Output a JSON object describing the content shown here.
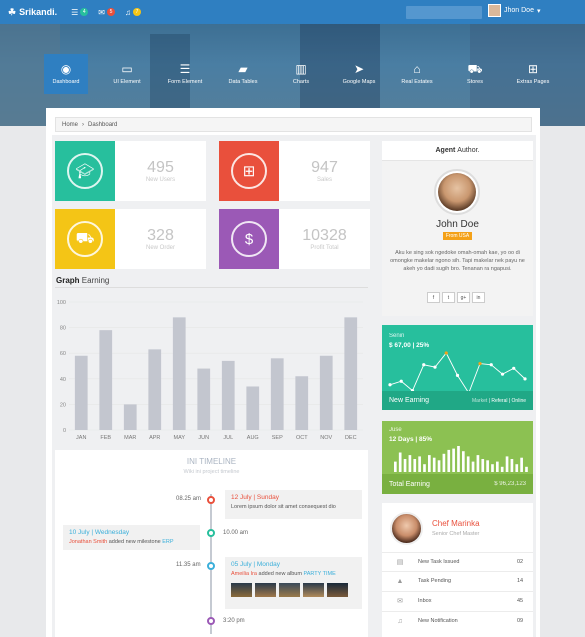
{
  "topbar": {
    "brand": "Srikandi.",
    "badges": [
      "4",
      "5",
      "7"
    ],
    "search_placeholder": "",
    "user": "Jhon Doe"
  },
  "nav": [
    {
      "label": "Dashboard",
      "icon": "dashboard-icon"
    },
    {
      "label": "UI Element",
      "icon": "laptop-icon"
    },
    {
      "label": "Form Element",
      "icon": "list-icon"
    },
    {
      "label": "Data Tables",
      "icon": "folder-icon"
    },
    {
      "label": "Charts",
      "icon": "bar-chart-icon"
    },
    {
      "label": "Google Maps",
      "icon": "location-icon"
    },
    {
      "label": "Real Estates",
      "icon": "home-icon"
    },
    {
      "label": "Stores",
      "icon": "cart-icon"
    },
    {
      "label": "Extras Pages",
      "icon": "plus-icon"
    }
  ],
  "breadcrumb": {
    "home": "Home",
    "current": "Dashboard"
  },
  "stats": [
    {
      "value": "495",
      "label": "New Users",
      "color": "#27bf9d",
      "icon": "graduation-cap-icon"
    },
    {
      "value": "947",
      "label": "Sales",
      "color": "#e9503c",
      "icon": "gift-icon"
    },
    {
      "value": "328",
      "label": "New Order",
      "color": "#f4c516",
      "icon": "cart-icon"
    },
    {
      "value": "10328",
      "label": "Profit Total",
      "color": "#9b59b6",
      "icon": "money-icon"
    }
  ],
  "graph": {
    "title_bold": "Graph",
    "title_rest": "Earning"
  },
  "chart_data": {
    "type": "bar",
    "categories": [
      "JAN",
      "FEB",
      "MAR",
      "APR",
      "MAY",
      "JUN",
      "JUL",
      "AUG",
      "SEP",
      "OCT",
      "NOV",
      "DEC"
    ],
    "values": [
      58,
      78,
      20,
      63,
      88,
      48,
      54,
      34,
      56,
      42,
      58,
      88
    ],
    "ylim": [
      0,
      100
    ],
    "yticks": [
      0,
      20,
      40,
      60,
      80,
      100
    ],
    "bar_color": "#c3c6cf"
  },
  "timeline": {
    "title": "INI TIMELINE",
    "subtitle": "Wiki ini project timeline",
    "events": [
      {
        "time": "08.25 am",
        "title": "12 July | Sunday",
        "text": "Lorem ipsum dolor sit amet consequest dio",
        "side": "right",
        "color": "#e9503c"
      },
      {
        "time": "10.00 am",
        "title": "10 July | Wednesday",
        "text_name": "Jonathan Smith",
        "text": "added new milestone",
        "text_tag": "ERP",
        "side": "left",
        "color": "#27bf9d"
      },
      {
        "time": "11.35 am",
        "title": "05 July | Monday",
        "text_name": "Ameilia Ira",
        "text": "added new album",
        "text_tag": "PARTY TIME",
        "side": "right",
        "color": "#3bafda"
      },
      {
        "time": "3:20 pm",
        "title": "",
        "text": "",
        "side": "right",
        "color": "#9b59b6"
      }
    ]
  },
  "agent": {
    "title_bold": "Agent",
    "title_rest": "Author.",
    "name": "John Doe",
    "tag": "From USA",
    "bio": "Aku ke sing sok ngedoke omah-omah kae, yo oo di omongke makelar ngono sih. Tapi makelar nek payu ne akeh yo dadi sugih bro. Tenanan ra ngapusi.",
    "social": [
      "f",
      "t",
      "g+",
      "in"
    ]
  },
  "sales_graph": {
    "title": "Senin",
    "value": "$ 67,00 | 25%",
    "footer": "New Earning",
    "links": [
      "Market",
      "Referal",
      "Online"
    ],
    "color": "#27bf9d",
    "points": [
      55,
      58,
      50,
      72,
      70,
      82,
      63,
      48,
      73,
      72,
      64,
      69,
      60
    ]
  },
  "total_graph": {
    "title": "Juse",
    "value": "12 Days | 85%",
    "footer": "Total Earning",
    "amount": "$ 96,23,123",
    "color": "#8cc152",
    "bars": [
      40,
      75,
      50,
      65,
      50,
      60,
      30,
      65,
      55,
      45,
      70,
      85,
      90,
      100,
      80,
      60,
      40,
      65,
      50,
      45,
      30,
      40,
      20,
      60,
      50,
      30,
      55,
      20
    ]
  },
  "chef": {
    "name": "Chef Marinka",
    "role": "Senior Chef Master",
    "rows": [
      {
        "icon": "message-icon",
        "label": "New Task Issued",
        "value": "02"
      },
      {
        "icon": "warning-icon",
        "label": "Task Pending",
        "value": "14"
      },
      {
        "icon": "inbox-icon",
        "label": "Inbox",
        "value": "45"
      },
      {
        "icon": "bell-icon",
        "label": "New Notification",
        "value": "09"
      }
    ]
  }
}
